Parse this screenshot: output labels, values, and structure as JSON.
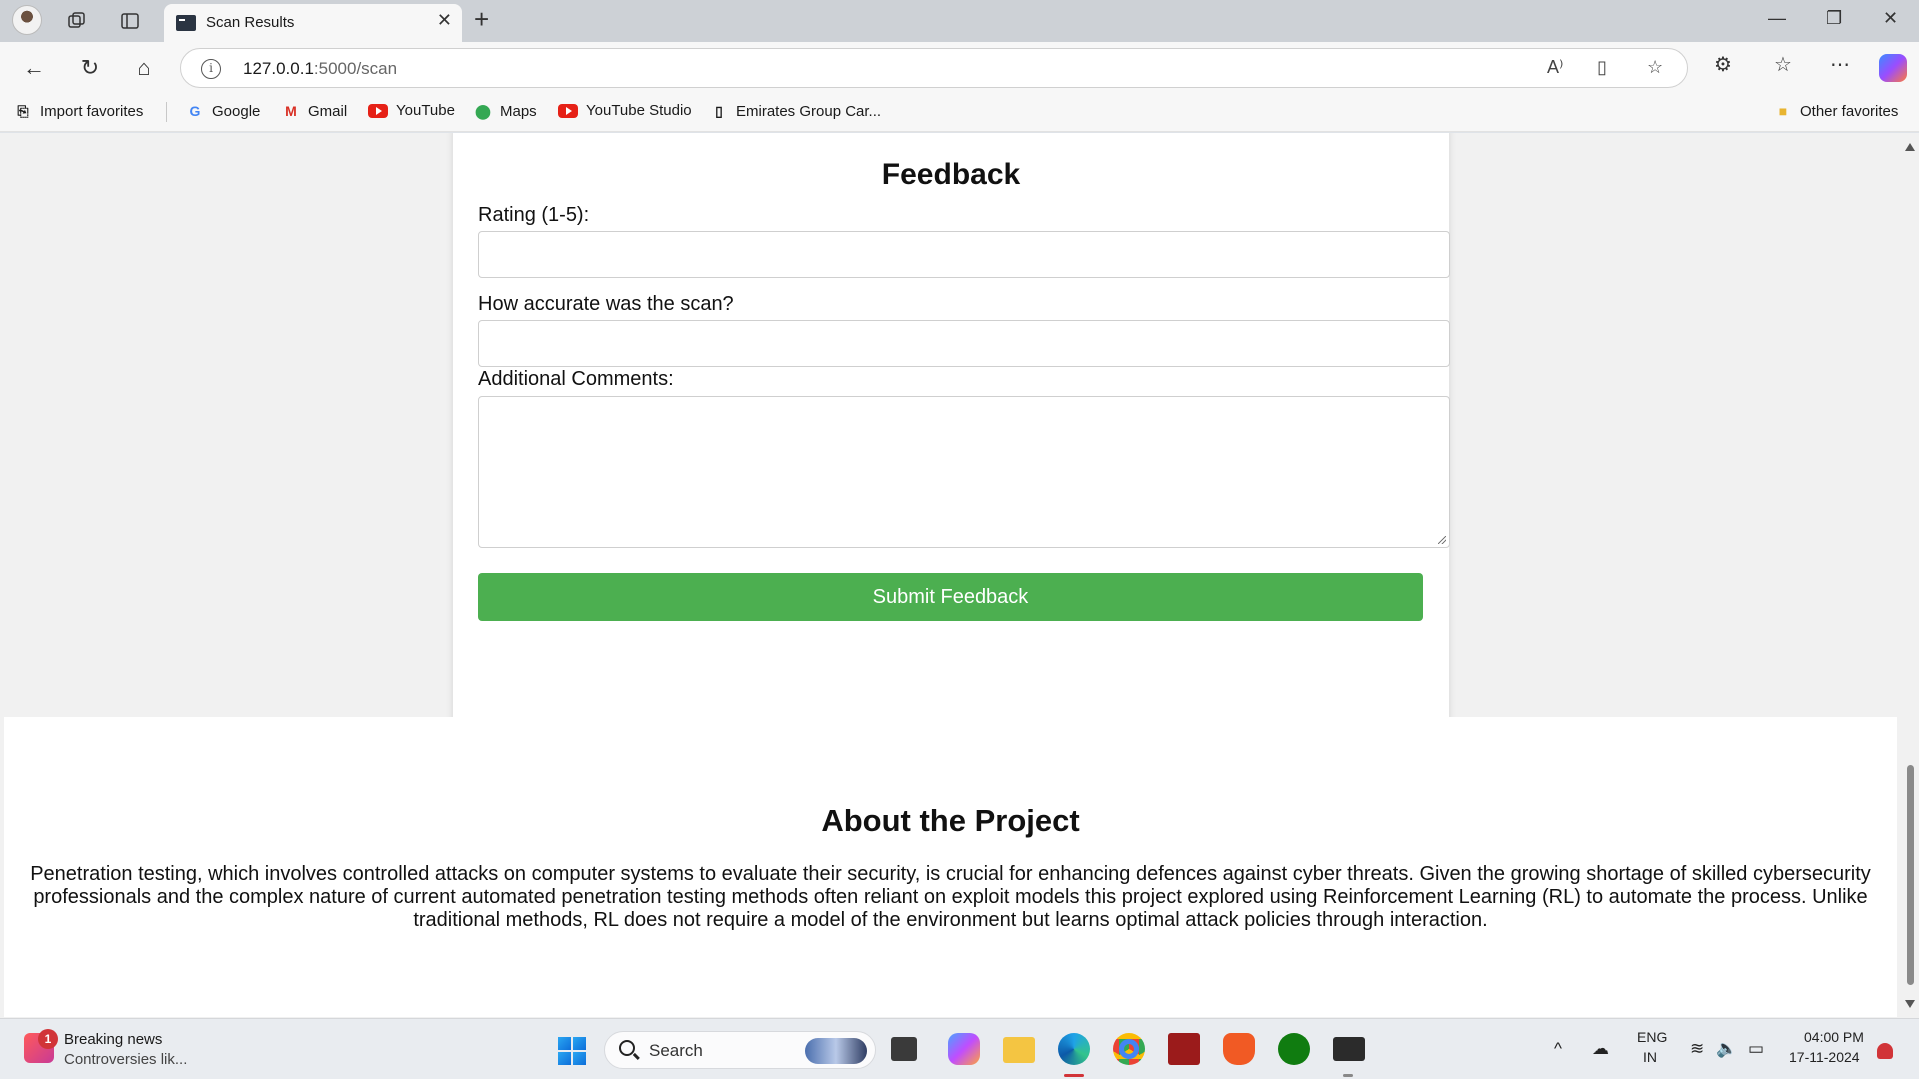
{
  "browser": {
    "tab_title": "Scan Results",
    "url_host": "127.0.0.1",
    "url_path": ":5000/scan",
    "favorites": [
      {
        "label": "Import favorites",
        "icon": "import-icon"
      },
      {
        "label": "Google",
        "icon": "google-icon"
      },
      {
        "label": "Gmail",
        "icon": "gmail-icon"
      },
      {
        "label": "YouTube",
        "icon": "youtube-icon"
      },
      {
        "label": "Maps",
        "icon": "maps-icon"
      },
      {
        "label": "YouTube Studio",
        "icon": "youtube-studio-icon"
      },
      {
        "label": "Emirates Group Car...",
        "icon": "page-icon"
      }
    ],
    "other_favorites": "Other favorites"
  },
  "feedback": {
    "title": "Feedback",
    "rating_label": "Rating (1-5):",
    "rating_value": "",
    "accuracy_label": "How accurate was the scan?",
    "accuracy_value": "",
    "comments_label": "Additional Comments:",
    "comments_value": "",
    "submit_label": "Submit Feedback",
    "submit_color": "#4caf50"
  },
  "about": {
    "title": "About the Project",
    "text": "Penetration testing, which involves controlled attacks on computer systems to evaluate their security, is crucial for enhancing defences against cyber threats. Given the growing shortage of skilled cybersecurity professionals and the complex nature of current automated penetration testing methods often reliant on exploit models this project explored using Reinforcement Learning (RL) to automate the process. Unlike traditional methods, RL does not require a model of the environment but learns optimal attack policies through interaction."
  },
  "taskbar": {
    "news_badge": "1",
    "news_title": "Breaking news",
    "news_subtitle": "Controversies lik...",
    "search_placeholder": "Search",
    "lang_top": "ENG",
    "lang_bottom": "IN",
    "time": "04:00 PM",
    "date": "17-11-2024"
  }
}
